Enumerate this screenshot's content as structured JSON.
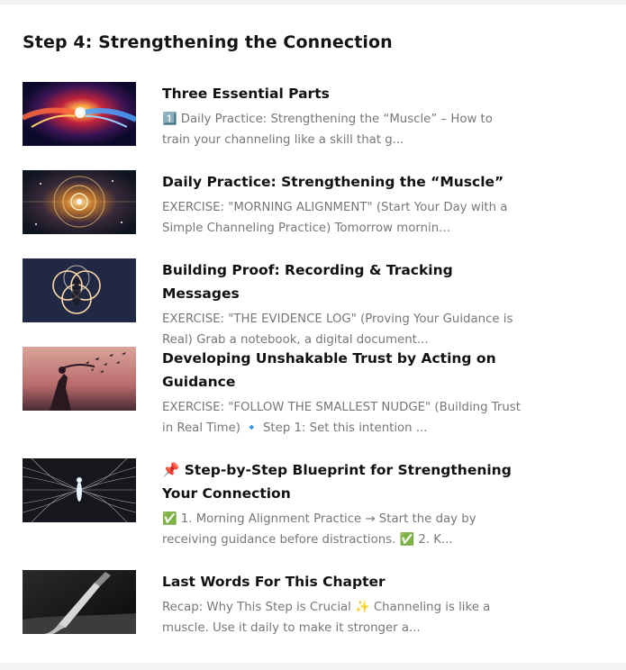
{
  "section": {
    "title": "Step 4: Strengthening the Connection"
  },
  "items": [
    {
      "title": "Three Essential Parts",
      "excerpt": "1️⃣ Daily Practice: Strengthening the “Muscle” – How to train your channeling like a skill that g...",
      "thumbnail_icon": "glowing-hands-image"
    },
    {
      "title": "Daily Practice: Strengthening the “Muscle”",
      "excerpt": "EXERCISE: \"MORNING ALIGNMENT\" (Start Your Day with a Simple Channeling Practice) Tomorrow mornin...",
      "thumbnail_icon": "cosmic-mandala-image"
    },
    {
      "title": "Building Proof: Recording & Tracking Messages",
      "excerpt": "EXERCISE: \"THE EVIDENCE LOG\" (Proving Your Guidance is Real) Grab a notebook, a digital document...",
      "thumbnail_icon": "light-rings-figure-image"
    },
    {
      "title": "Developing Unshakable Trust by Acting on Guidance",
      "excerpt": "EXERCISE: \"FOLLOW THE SMALLEST NUDGE\" (Building Trust in Real Time) 🔹 Step 1: Set this intention ...",
      "thumbnail_icon": "woman-birds-sunset-image"
    },
    {
      "title": "📌 Step-by-Step Blueprint for Strengthening Your Connection",
      "excerpt": "✅ 1. Morning Alignment Practice → Start the day by receiving guidance before distractions. ✅ 2. K...",
      "thumbnail_icon": "energy-figure-image"
    },
    {
      "title": "Last Words For This Chapter",
      "excerpt": "Recap: Why This Step is Crucial ✨ Channeling is like a muscle. Use it daily to make it stronger a...",
      "thumbnail_icon": "paintbrush-image"
    }
  ]
}
